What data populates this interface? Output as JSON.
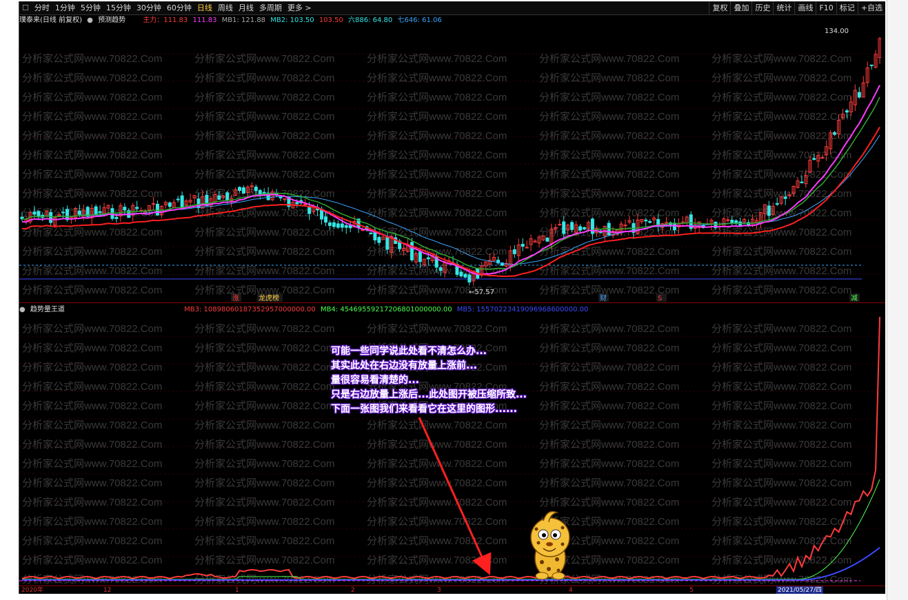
{
  "toolbar": {
    "items": [
      "分时",
      "1分钟",
      "5分钟",
      "15分钟",
      "30分钟",
      "60分钟",
      "日线",
      "周线",
      "月线",
      "多周期",
      "更多 >"
    ],
    "active": "日线",
    "right_items": [
      "复权",
      "叠加",
      "历史",
      "统计",
      "画线",
      "F10",
      "标记",
      "+自选"
    ]
  },
  "main_status": {
    "stock": "璞泰来(日线 前复权)",
    "indicator": "预测趋势",
    "zhuli": "主力：111.83",
    "zhuli_val": "111.83",
    "mb1": "MB1: 121.88",
    "mb2": "MB2: 103.50",
    "mb2_extra": "103.50",
    "liu": "六886: 64.80",
    "qi": "七646: 61.06"
  },
  "price_labels": {
    "high": "134.00",
    "low": "57.57"
  },
  "event_marks": [
    {
      "label": "涨",
      "color": "#ff3b3b"
    },
    {
      "label": "龙虎榜",
      "color": "#ffd24a"
    },
    {
      "label": "财",
      "color": "#4aa8ff"
    },
    {
      "label": "S",
      "color": "#ff3b3b"
    },
    {
      "label": "减",
      "color": "#4cff4c"
    }
  ],
  "sub_status": {
    "indicator": "趋势量王道",
    "mb3": "MB3: 10898060187352957000000.00",
    "mb4": "MB4: 45469559217206801000000.00",
    "mb5": "MB5: 15570223419096968600000.00"
  },
  "annotation": {
    "lines": [
      "可能一些同学说此处看不清怎么办...",
      "其实此处在右边没有放量上涨前...",
      "量很容易看清楚的...",
      "只是右边放量上涨后...此处图开被压缩所致...",
      "下面一张图我们来看看它在这里的图形......"
    ]
  },
  "watermark": "分析家公式网www.70822.Com",
  "date_axis": {
    "labels": [
      "2020年",
      "12",
      "1",
      "2",
      "3",
      "4",
      "5",
      "2021/05/27/四"
    ]
  },
  "colors": {
    "up": "#ff3b3b",
    "down": "#35e6e6",
    "ma_pink": "#ff3bff",
    "ma_green": "#2ea82e",
    "ma_blue": "#3aa6ff",
    "ma_red": "#ff2020"
  }
}
